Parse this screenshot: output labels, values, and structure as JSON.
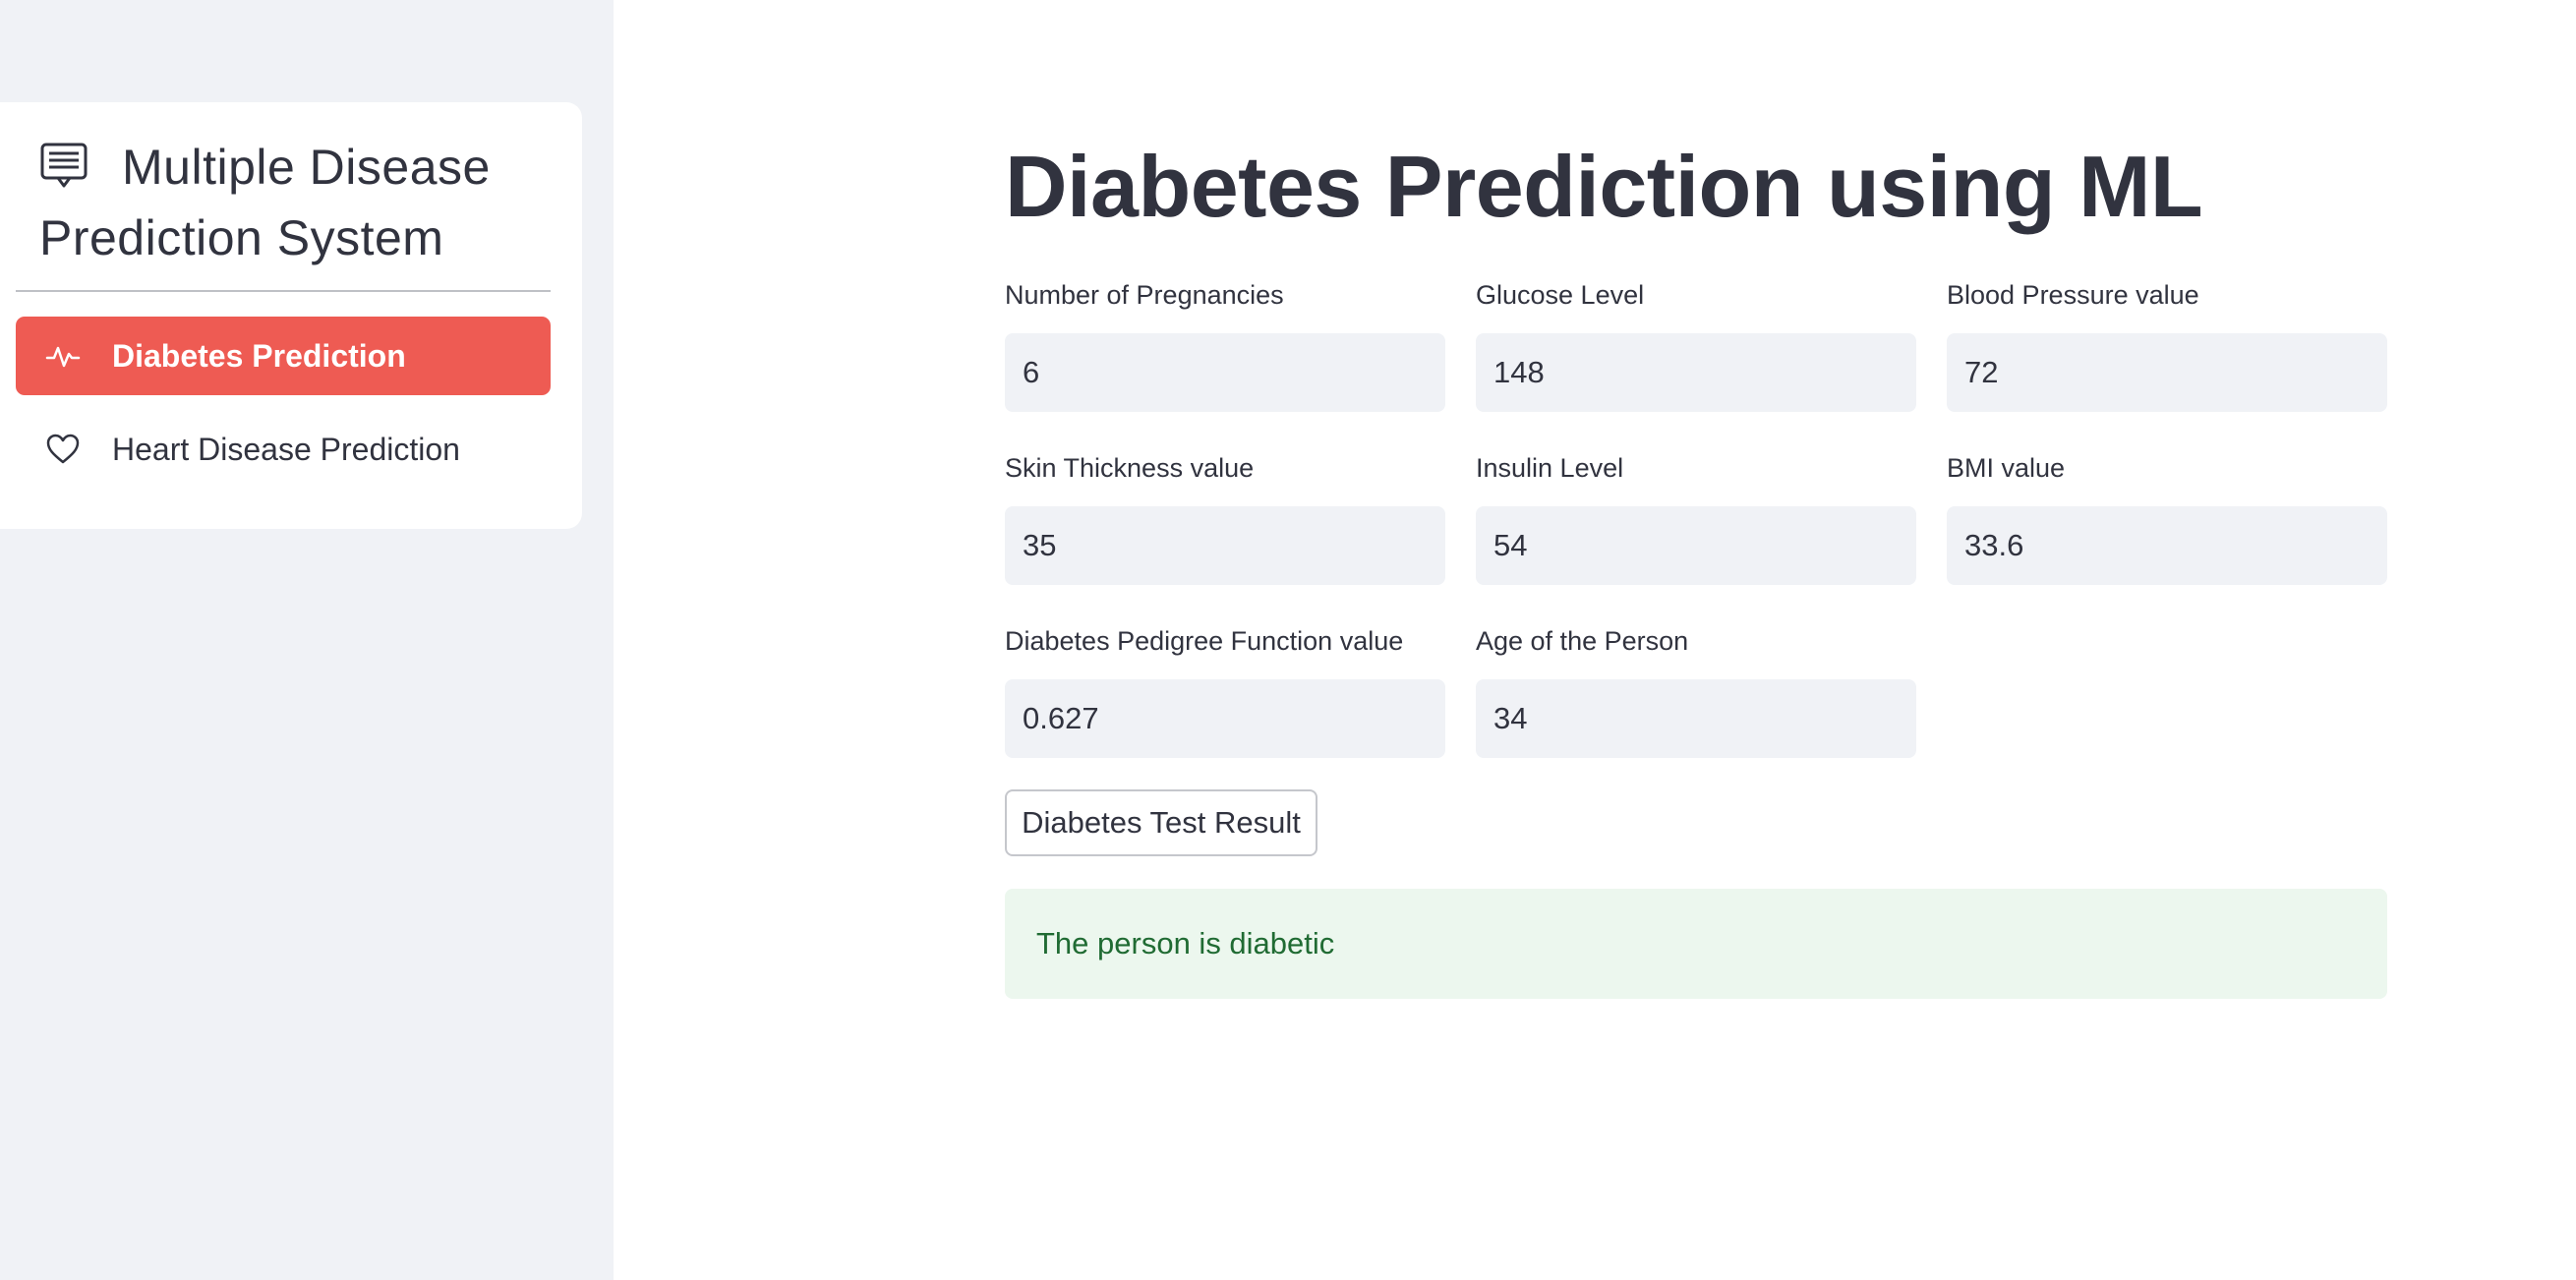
{
  "sidebar": {
    "menu_title": "Multiple Disease Prediction System",
    "title_icon": "list-card-icon",
    "items": [
      {
        "label": "Diabetes Prediction",
        "icon": "activity-icon",
        "active": true
      },
      {
        "label": "Heart Disease Prediction",
        "icon": "heart-icon",
        "active": false
      }
    ],
    "active_color": "#ee5b53"
  },
  "main": {
    "title": "Diabetes Prediction using ML",
    "fields": [
      {
        "label": "Number of Pregnancies",
        "value": "6"
      },
      {
        "label": "Glucose Level",
        "value": "148"
      },
      {
        "label": "Blood Pressure value",
        "value": "72"
      },
      {
        "label": "Skin Thickness value",
        "value": "35"
      },
      {
        "label": "Insulin Level",
        "value": "54"
      },
      {
        "label": "BMI value",
        "value": "33.6"
      },
      {
        "label": "Diabetes Pedigree Function value",
        "value": "0.627"
      },
      {
        "label": "Age of the Person",
        "value": "34"
      }
    ],
    "button_label": "Diabetes Test Result",
    "result": "The person is diabetic",
    "result_color": "#206b33"
  }
}
